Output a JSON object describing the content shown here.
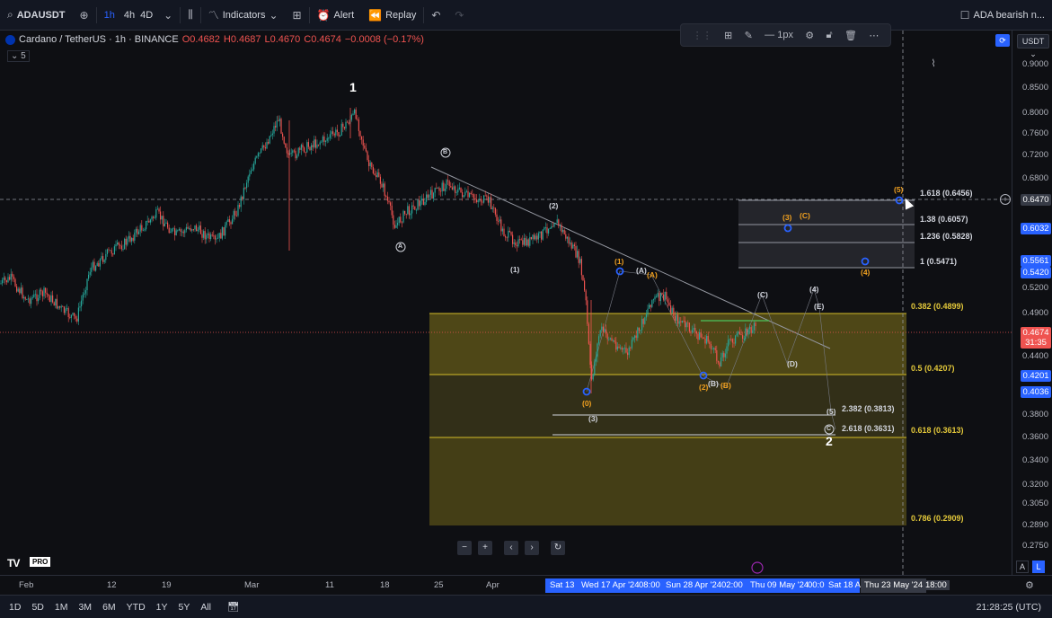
{
  "topbar": {
    "symbol": "ADAUSDT",
    "intervals": [
      "1h",
      "4h",
      "4D"
    ],
    "active_interval": "1h",
    "indicators_label": "Indicators",
    "alert_label": "Alert",
    "replay_label": "Replay",
    "layout_name": "ADA bearish n..."
  },
  "legend": {
    "title": "Cardano / TetherUS · 1h · BINANCE",
    "open": "O0.4682",
    "high": "H0.4687",
    "low": "L0.4670",
    "close": "C0.4674",
    "change": "−0.0008 (−0.17%)",
    "sub": "5"
  },
  "draw_toolbar": {
    "width_label": "1px"
  },
  "currency_label": "USDT",
  "price_axis": {
    "ticks": [
      "0.9000",
      "0.8500",
      "0.8000",
      "0.7600",
      "0.7200",
      "0.6800",
      "0.6470",
      "0.6032",
      "0.5561",
      "0.5420",
      "0.5200",
      "0.4900",
      "0.4674",
      "0.4400",
      "0.4201",
      "0.4036",
      "0.3800",
      "0.3600",
      "0.3400",
      "0.3200",
      "0.3050",
      "0.2890",
      "0.2750"
    ],
    "tag_dash": "0.6470",
    "tag_blue1": "0.6032",
    "tag_blue2": "0.5561",
    "tag_blue3": "0.5420",
    "tag_last": "0.4674",
    "tag_countdown": "31:35",
    "tag_blue4": "0.4201",
    "tag_blue5": "0.4036"
  },
  "fib_labels": {
    "f1618": "1.618 (0.6456)",
    "f138": "1.38 (0.6057)",
    "f1236": "1.236 (0.5828)",
    "f1": "1 (0.5471)",
    "f0382": "0.382 (0.4899)",
    "f05": "0.5 (0.4207)",
    "f2382": "2.382 (0.3813)",
    "f2618": "2.618 (0.3631)",
    "f0618": "0.618 (0.3613)",
    "f0786": "0.786 (0.2909)"
  },
  "waves": {
    "w1": "1",
    "w2": "2",
    "wB": "B",
    "wA": "A",
    "wC": "C",
    "p1": "(1)",
    "p2": "(2)",
    "p3": "(3)",
    "p4": "(4)",
    "p5": "(5)",
    "pA": "(A)",
    "pB": "(B)",
    "pC": "(C)",
    "pD": "(D)",
    "pE": "(E)",
    "p0": "(0)"
  },
  "time_axis": {
    "labels": [
      "Feb",
      "12",
      "19",
      "Mar",
      "11",
      "18",
      "25",
      "Apr"
    ],
    "highlight1": "Sat 13",
    "highlight2": "Wed 17 Apr '24",
    "highlight3": "08:00",
    "highlight4": "Sun 28 Apr '24",
    "highlight5": "02:00",
    "highlight6": "Thu 09 May '24",
    "highlight7": "00:0",
    "highlight8": "Sat 18 A",
    "cursor_time": "Thu 23 May '24",
    "after_cursor": "18:00"
  },
  "bottombar": {
    "ranges": [
      "1D",
      "5D",
      "1M",
      "3M",
      "6M",
      "YTD",
      "1Y",
      "5Y",
      "All"
    ],
    "clock": "21:28:25 (UTC)"
  },
  "logo_text": "TV",
  "logo_badge": "PRO",
  "colors": {
    "accent": "#2962ff",
    "down": "#ef5350",
    "up": "#26a69a",
    "fib_zone": "#b8a31f"
  }
}
